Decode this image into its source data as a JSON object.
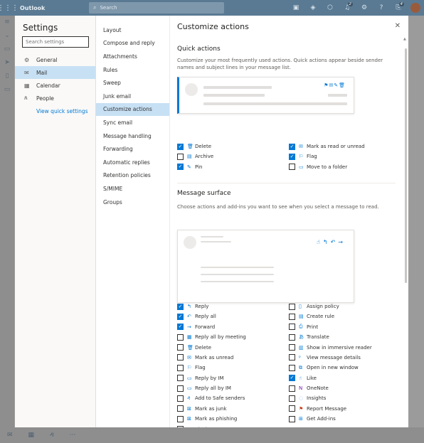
{
  "app": {
    "name": "Outlook",
    "search_placeholder": "Search",
    "search_icon": "search-icon",
    "topbar_icons": [
      "skype-icon",
      "teams-icon",
      "my-day-icon",
      "whats-new-icon",
      "settings-icon",
      "help-icon",
      "feedback-icon"
    ],
    "whats_new_badge": "2",
    "feedback_badge": "4"
  },
  "settings": {
    "title": "Settings",
    "search_placeholder": "Search settings",
    "nav": [
      {
        "label": "General",
        "icon": "gear-icon"
      },
      {
        "label": "Mail",
        "icon": "mail-icon",
        "selected": true
      },
      {
        "label": "Calendar",
        "icon": "calendar-icon"
      },
      {
        "label": "People",
        "icon": "people-icon"
      }
    ],
    "quick_link": "View quick settings",
    "subnav": [
      {
        "label": "Layout"
      },
      {
        "label": "Compose and reply"
      },
      {
        "label": "Attachments"
      },
      {
        "label": "Rules"
      },
      {
        "label": "Sweep"
      },
      {
        "label": "Junk email"
      },
      {
        "label": "Customize actions",
        "selected": true
      },
      {
        "label": "Sync email"
      },
      {
        "label": "Message handling"
      },
      {
        "label": "Forwarding"
      },
      {
        "label": "Automatic replies"
      },
      {
        "label": "Retention policies"
      },
      {
        "label": "S/MIME"
      },
      {
        "label": "Groups"
      }
    ]
  },
  "panel": {
    "title": "Customize actions",
    "close_icon": "close-icon",
    "quick_actions": {
      "title": "Quick actions",
      "description": "Customize your most frequently used actions. Quick actions appear beside sender names and subject lines in your message list.",
      "left": [
        {
          "label": "Delete",
          "checked": true,
          "icon": "trash-icon"
        },
        {
          "label": "Archive",
          "checked": false,
          "icon": "archive-icon"
        },
        {
          "label": "Pin",
          "checked": true,
          "icon": "pin-icon"
        }
      ],
      "right": [
        {
          "label": "Mark as read or unread",
          "checked": true,
          "icon": "envelope-icon"
        },
        {
          "label": "Flag",
          "checked": true,
          "icon": "flag-icon"
        },
        {
          "label": "Move to a folder",
          "checked": false,
          "icon": "folder-icon"
        }
      ]
    },
    "message_surface": {
      "title": "Message surface",
      "description": "Choose actions and add-ins you want to see when you select a message to read.",
      "left": [
        {
          "label": "Reply",
          "checked": true,
          "icon": "reply-icon"
        },
        {
          "label": "Reply all",
          "checked": true,
          "icon": "reply-all-icon"
        },
        {
          "label": "Forward",
          "checked": true,
          "icon": "forward-icon"
        },
        {
          "label": "Reply all by meeting",
          "checked": false,
          "icon": "meeting-icon"
        },
        {
          "label": "Delete",
          "checked": false,
          "icon": "trash-icon"
        },
        {
          "label": "Mark as unread",
          "checked": false,
          "icon": "envelope-icon"
        },
        {
          "label": "Flag",
          "checked": false,
          "icon": "flag-icon"
        },
        {
          "label": "Reply by IM",
          "checked": false,
          "icon": "chat-icon"
        },
        {
          "label": "Reply all by IM",
          "checked": false,
          "icon": "chat-icon"
        },
        {
          "label": "Add to Safe senders",
          "checked": false,
          "icon": "person-icon"
        },
        {
          "label": "Mark as junk",
          "checked": false,
          "icon": "junk-icon"
        },
        {
          "label": "Mark as phishing",
          "checked": false,
          "icon": "phishing-icon"
        },
        {
          "label": "Block",
          "checked": false,
          "icon": "block-icon"
        }
      ],
      "right": [
        {
          "label": "Assign policy",
          "checked": false,
          "icon": "policy-icon"
        },
        {
          "label": "Create rule",
          "checked": false,
          "icon": "rule-icon"
        },
        {
          "label": "Print",
          "checked": false,
          "icon": "print-icon"
        },
        {
          "label": "Translate",
          "checked": false,
          "icon": "translate-icon"
        },
        {
          "label": "Show in immersive reader",
          "checked": false,
          "icon": "immersive-reader-icon"
        },
        {
          "label": "View message details",
          "checked": false,
          "icon": "details-icon"
        },
        {
          "label": "Open in new window",
          "checked": false,
          "icon": "new-window-icon"
        },
        {
          "label": "Like",
          "checked": true,
          "icon": "like-icon"
        },
        {
          "label": "OneNote",
          "checked": false,
          "icon": "onenote-icon"
        },
        {
          "label": "Insights",
          "checked": false,
          "icon": "insights-icon"
        },
        {
          "label": "Report Message",
          "checked": false,
          "icon": "report-icon"
        },
        {
          "label": "Get Add-ins",
          "checked": false,
          "icon": "add-ins-icon"
        }
      ]
    }
  },
  "colors": {
    "accent": "#0078d4",
    "selected_bg": "#c7e0f4"
  }
}
